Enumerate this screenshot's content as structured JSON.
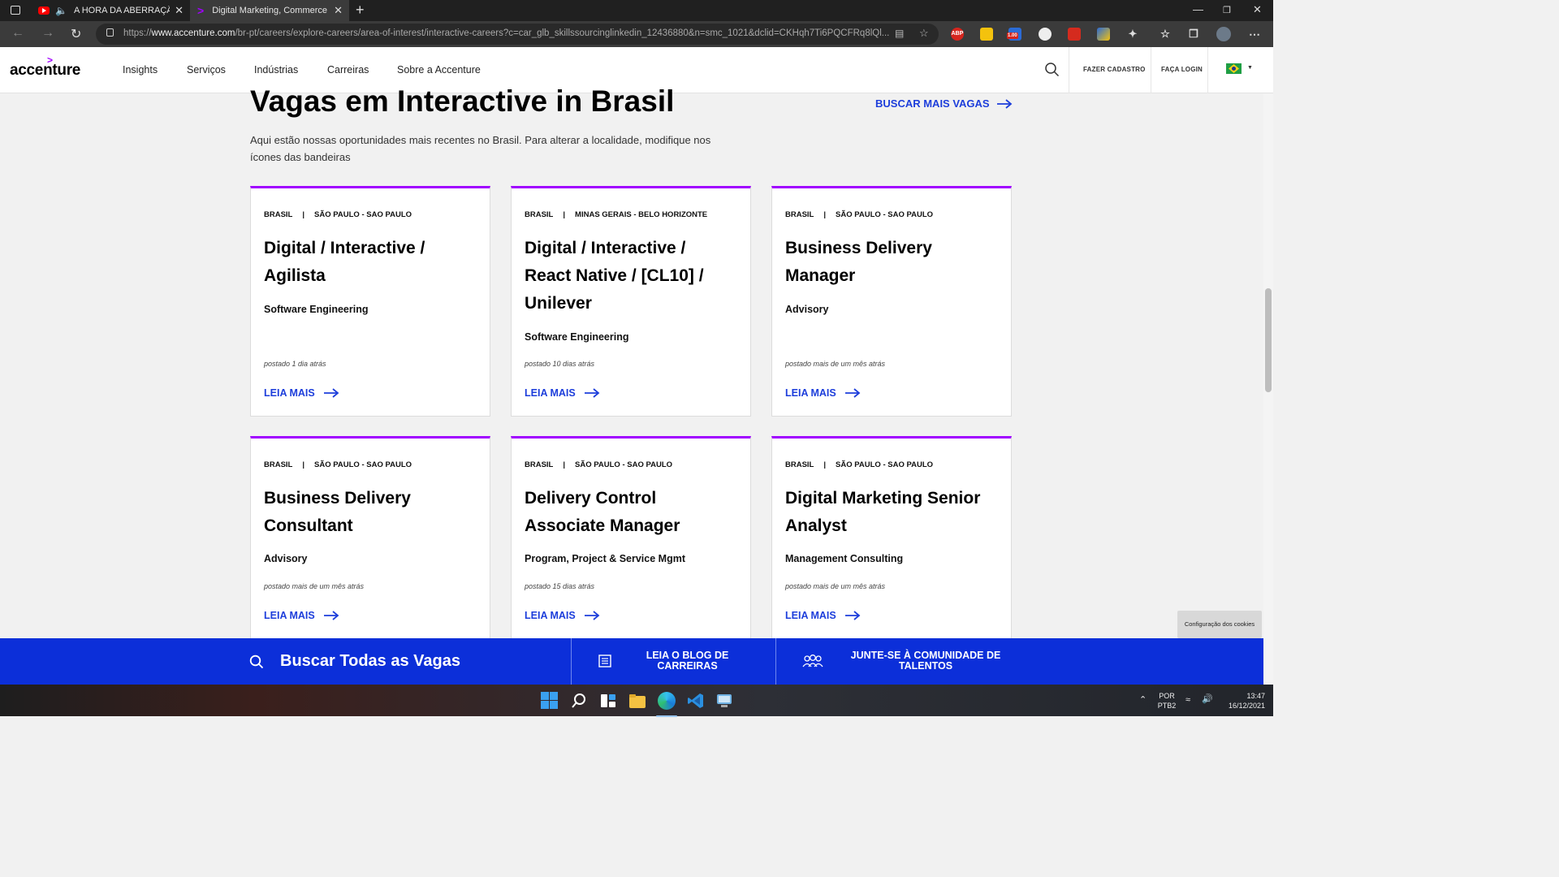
{
  "browser": {
    "tabs": [
      {
        "title": "A HORA DA ABERRAÇÃO? -",
        "active": false
      },
      {
        "title": "Digital Marketing, Commerce, De",
        "active": true
      }
    ],
    "url_prefix": "https://",
    "url_domain": "www.accenture.com",
    "url_path": "/br-pt/careers/explore-careers/area-of-interest/interactive-careers?c=car_glb_skillssourcinglinkedin_12436880&n=smc_1021&dclid=CKHqh7Ti6PQCFRq8lQl...",
    "extensions": {
      "abp": "ABP",
      "badge": "1.00"
    }
  },
  "site": {
    "logo": "accenture",
    "logo_mark": ">",
    "nav": [
      "Insights",
      "Serviços",
      "Indústrias",
      "Carreiras",
      "Sobre a Accenture"
    ],
    "signup": "FAZER CADASTRO",
    "login": "FAÇA LOGIN"
  },
  "main": {
    "heading": "Vagas em Interactive in Brasil",
    "more_jobs": "BUSCAR MAIS VAGAS",
    "intro": "Aqui estão nossas oportunidades mais recentes no Brasil. Para alterar a localidade, modifique nos ícones das bandeiras",
    "cards": [
      {
        "country": "BRASIL",
        "city": "SÃO PAULO - SAO PAULO",
        "title": "Digital / Interactive / Agilista",
        "category": "Software Engineering",
        "posted": "postado 1 dia atrás",
        "cta": "LEIA MAIS"
      },
      {
        "country": "BRASIL",
        "city": "MINAS GERAIS - BELO HORIZONTE",
        "title": "Digital / Interactive / React Native / [CL10] / Unilever",
        "category": "Software Engineering",
        "posted": "postado 10 dias atrás",
        "cta": "LEIA MAIS"
      },
      {
        "country": "BRASIL",
        "city": "SÃO PAULO - SAO PAULO",
        "title": "Business Delivery Manager",
        "category": "Advisory",
        "posted": "postado mais de um mês atrás",
        "cta": "LEIA MAIS"
      },
      {
        "country": "BRASIL",
        "city": "SÃO PAULO - SAO PAULO",
        "title": "Business Delivery Consultant",
        "category": "Advisory",
        "posted": "postado mais de um mês atrás",
        "cta": "LEIA MAIS"
      },
      {
        "country": "BRASIL",
        "city": "SÃO PAULO - SAO PAULO",
        "title": "Delivery Control Associate Manager",
        "category": "Program, Project & Service Mgmt",
        "posted": "postado 15 dias atrás",
        "cta": "LEIA MAIS"
      },
      {
        "country": "BRASIL",
        "city": "SÃO PAULO - SAO PAULO",
        "title": "Digital Marketing Senior Analyst",
        "category": "Management Consulting",
        "posted": "postado mais de um mês atrás",
        "cta": "LEIA MAIS"
      }
    ]
  },
  "bottom_bar": {
    "search_all": "Buscar Todas as Vagas",
    "blog": "LEIA O BLOG DE CARREIRAS",
    "community": "JUNTE-SE À COMUNIDADE DE TALENTOS"
  },
  "cookie_button": "Configuração dos cookies",
  "taskbar": {
    "lang_top": "POR",
    "lang_bottom": "PTB2",
    "time": "13:47",
    "date": "16/12/2021"
  },
  "colors": {
    "accent_purple": "#a100ff",
    "link_blue": "#1d3edb",
    "bar_blue": "#0c2fd9"
  }
}
